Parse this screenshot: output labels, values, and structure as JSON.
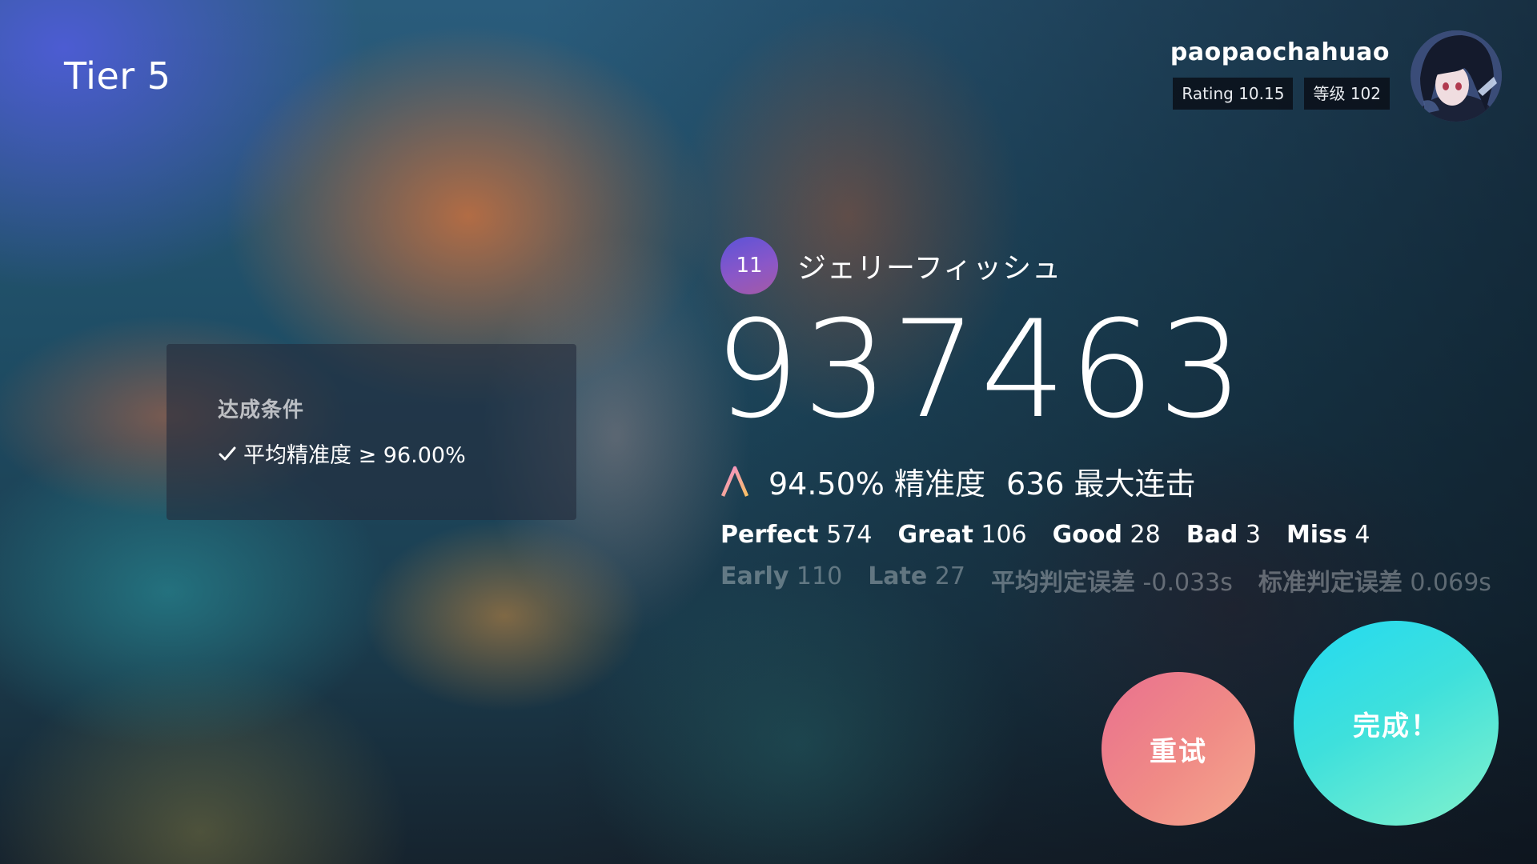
{
  "header": {
    "tier_label": "Tier 5"
  },
  "profile": {
    "username": "paopaochahuao",
    "rating": "Rating 10.15",
    "level": "等级 102"
  },
  "condition": {
    "title": "达成条件",
    "item": "平均精准度 ≥ 96.00%"
  },
  "song": {
    "difficulty": "11",
    "title": "ジェリーフィッシュ"
  },
  "result": {
    "score": "937463",
    "grade": "A",
    "accuracy": "94.50% 精准度",
    "max_combo": "636 最大连击",
    "perfect_label": "Perfect",
    "perfect_value": "574",
    "great_label": "Great",
    "great_value": "106",
    "good_label": "Good",
    "good_value": "28",
    "bad_label": "Bad",
    "bad_value": "3",
    "miss_label": "Miss",
    "miss_value": "4",
    "early_label": "Early",
    "early_value": "110",
    "late_label": "Late",
    "late_value": "27",
    "avg_offset_label": "平均判定误差",
    "avg_offset_value": "-0.033s",
    "std_offset_label": "标准判定误差",
    "std_offset_value": "0.069s"
  },
  "buttons": {
    "retry": "重试",
    "done": "完成！"
  },
  "colors": {
    "retry_start": "#e9708f",
    "retry_end": "#f5a88e",
    "done_start": "#23daf2",
    "done_end": "#83f2cc",
    "level_start": "#5b53d8",
    "level_end": "#a45aa5"
  }
}
